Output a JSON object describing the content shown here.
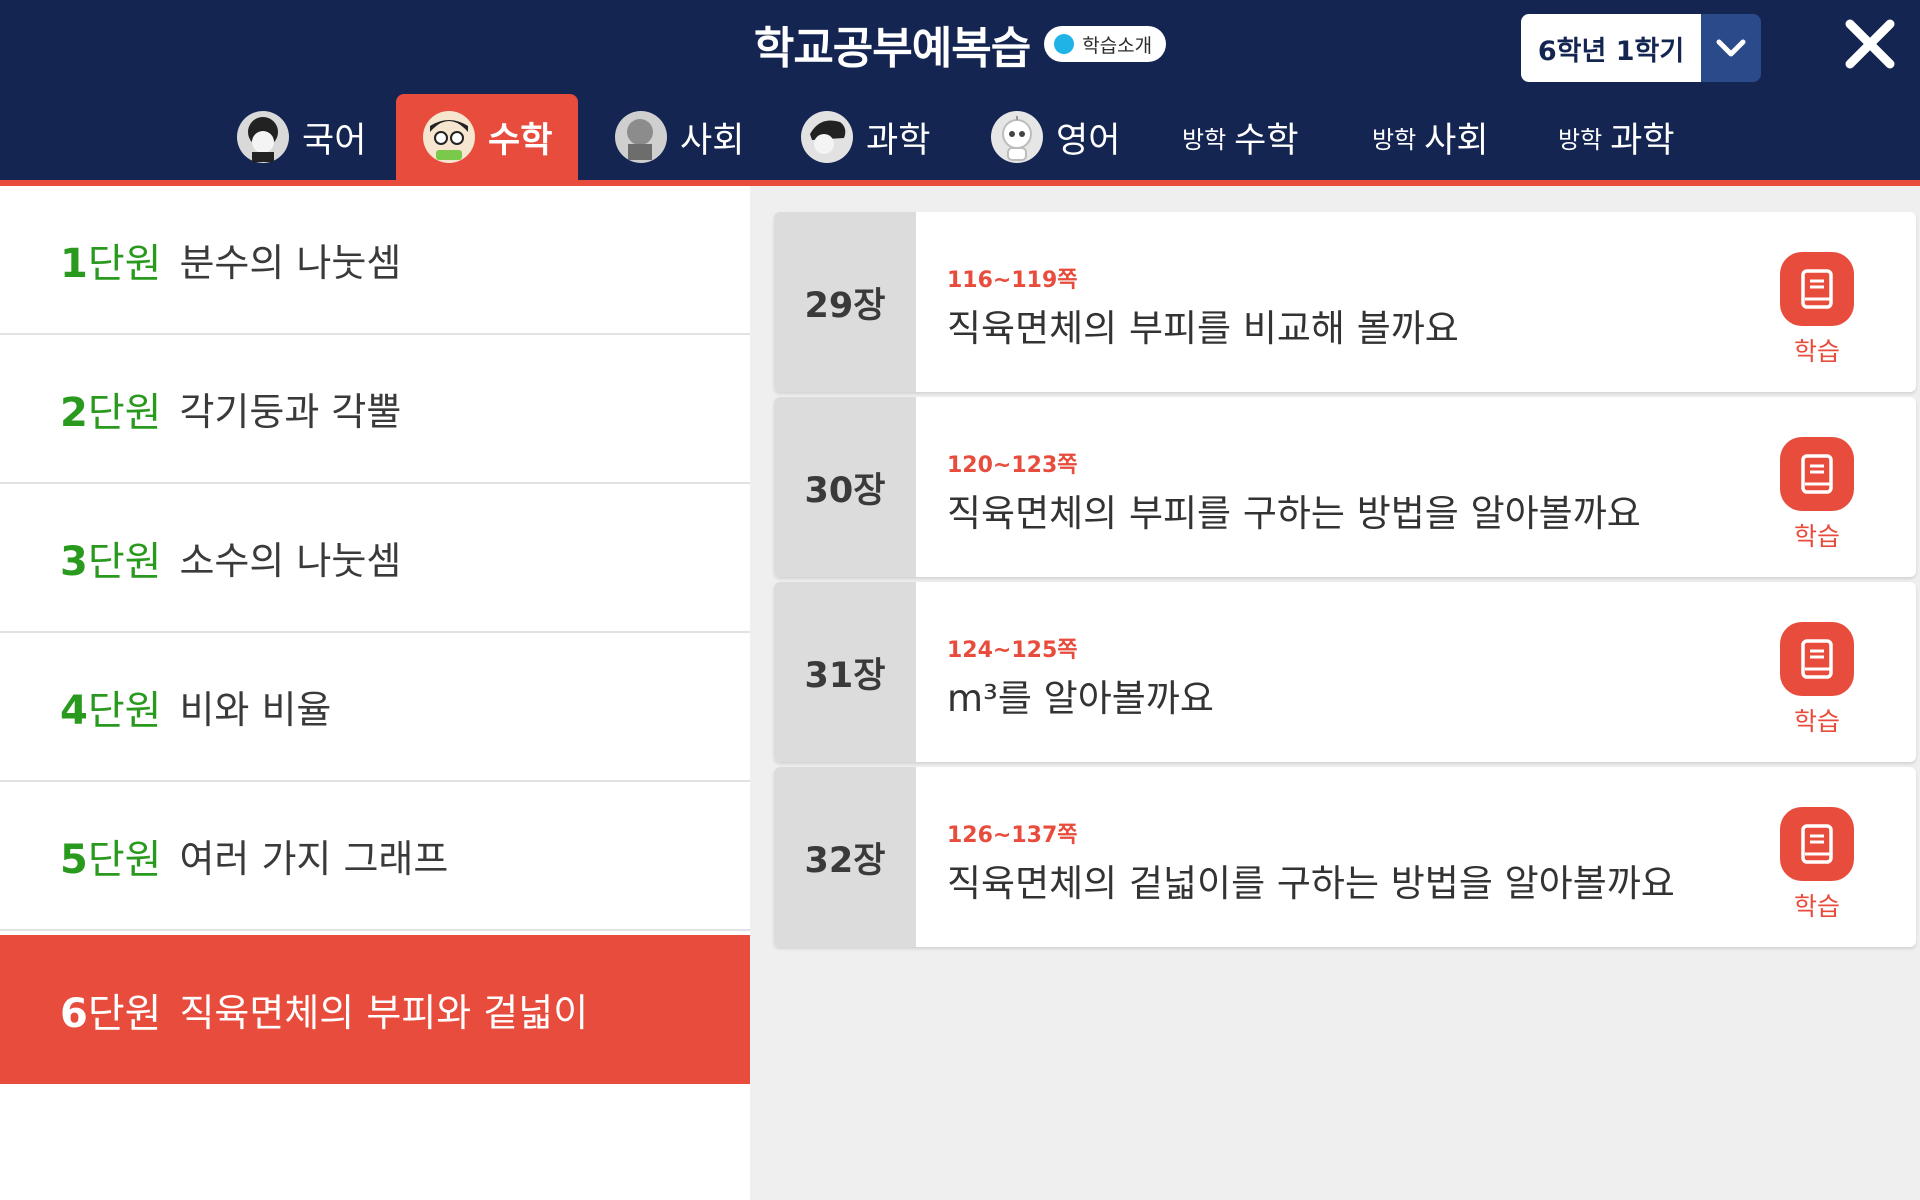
{
  "header": {
    "title": "학교공부예복습",
    "intro_label": "학습소개",
    "grade": "6학년 1학기"
  },
  "tabs": [
    {
      "label": "국어",
      "active": false
    },
    {
      "label": "수학",
      "active": true
    },
    {
      "label": "사회",
      "active": false
    },
    {
      "label": "과학",
      "active": false
    },
    {
      "label": "영어",
      "active": false
    },
    {
      "prefix": "방학",
      "label": "수학",
      "active": false
    },
    {
      "prefix": "방학",
      "label": "사회",
      "active": false
    },
    {
      "prefix": "방학",
      "label": "과학",
      "active": false
    }
  ],
  "units": [
    {
      "num": "1",
      "word": "단원",
      "name": "분수의 나눗셈"
    },
    {
      "num": "2",
      "word": "단원",
      "name": "각기둥과 각뿔"
    },
    {
      "num": "3",
      "word": "단원",
      "name": "소수의 나눗셈"
    },
    {
      "num": "4",
      "word": "단원",
      "name": "비와 비율"
    },
    {
      "num": "5",
      "word": "단원",
      "name": "여러 가지 그래프"
    },
    {
      "num": "6",
      "word": "단원",
      "name": "직육면체의 부피와 겉넓이",
      "active": true
    }
  ],
  "lessons": [
    {
      "chapter": "29장",
      "pages": "116~119쪽",
      "title": "직육면체의 부피를 비교해 볼까요",
      "button": "학습"
    },
    {
      "chapter": "30장",
      "pages": "120~123쪽",
      "title": "직육면체의 부피를 구하는 방법을 알아볼까요",
      "button": "학습"
    },
    {
      "chapter": "31장",
      "pages": "124~125쪽",
      "title": "m³를 알아볼까요",
      "button": "학습"
    },
    {
      "chapter": "32장",
      "pages": "126~137쪽",
      "title": "직육면체의 겉넓이를 구하는 방법을 알아볼까요",
      "button": "학습"
    }
  ],
  "colors": {
    "header_bg": "#142552",
    "accent": "#e84c3d",
    "unit_number": "#2a9a1f",
    "intro_dot": "#1fb3e6"
  },
  "icons": {
    "close": "close-icon",
    "dropdown": "chevron-down-icon",
    "study": "book-icon"
  }
}
